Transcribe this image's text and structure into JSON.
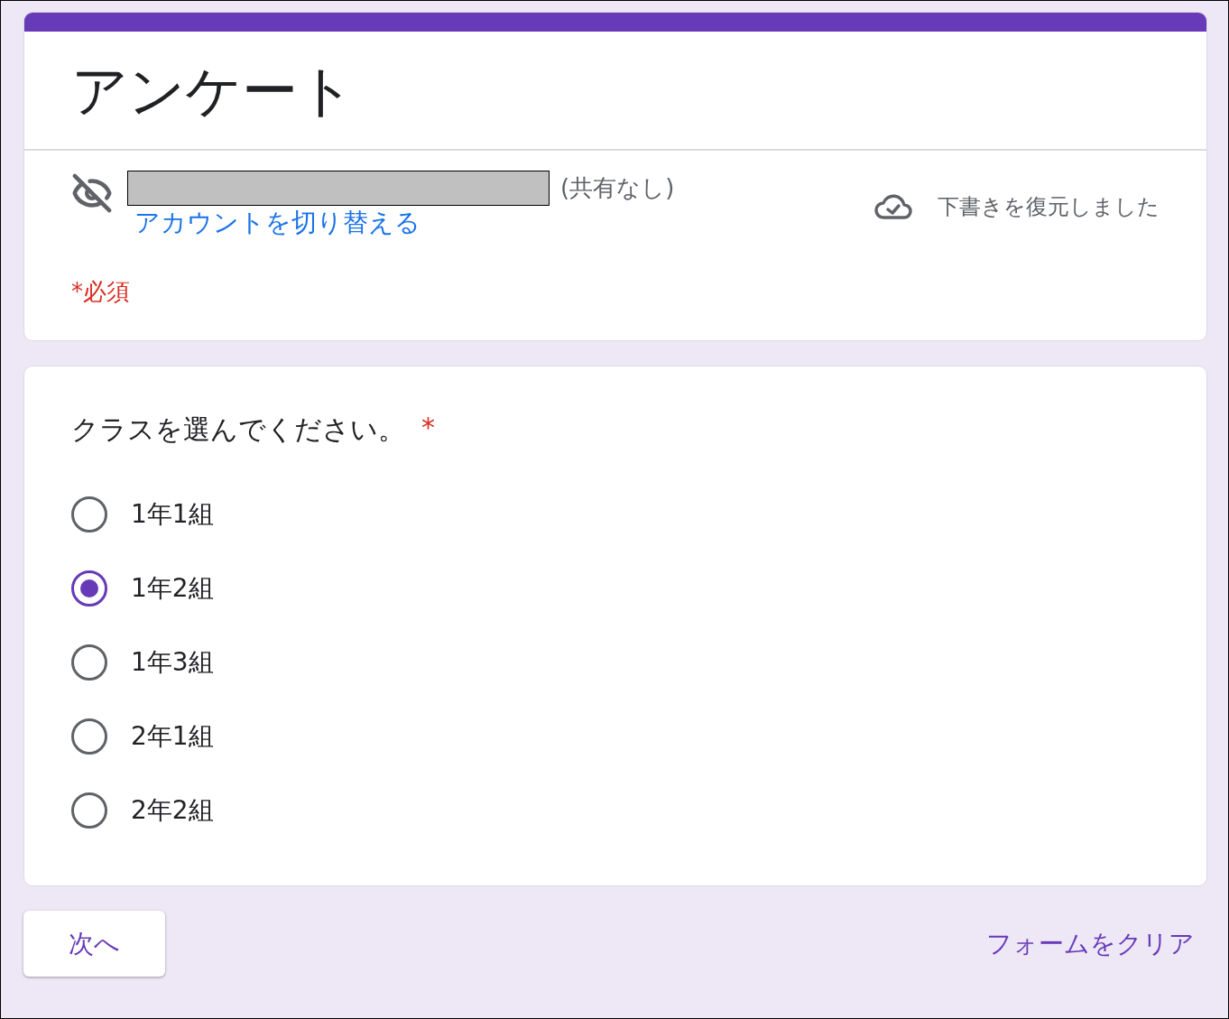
{
  "form": {
    "title": "アンケート"
  },
  "account": {
    "hidden": true,
    "share_status": "(共有なし)",
    "switch_link": "アカウントを切り替える"
  },
  "draft_status": "下書きを復元しました",
  "required_note": "*必須",
  "question": {
    "text": "クラスを選んでください。",
    "required": true,
    "required_mark": "*",
    "options": [
      {
        "label": "1年1組",
        "selected": false
      },
      {
        "label": "1年2組",
        "selected": true
      },
      {
        "label": "1年3組",
        "selected": false
      },
      {
        "label": "2年1組",
        "selected": false
      },
      {
        "label": "2年2組",
        "selected": false
      }
    ]
  },
  "buttons": {
    "next": "次へ",
    "clear": "フォームをクリア"
  }
}
